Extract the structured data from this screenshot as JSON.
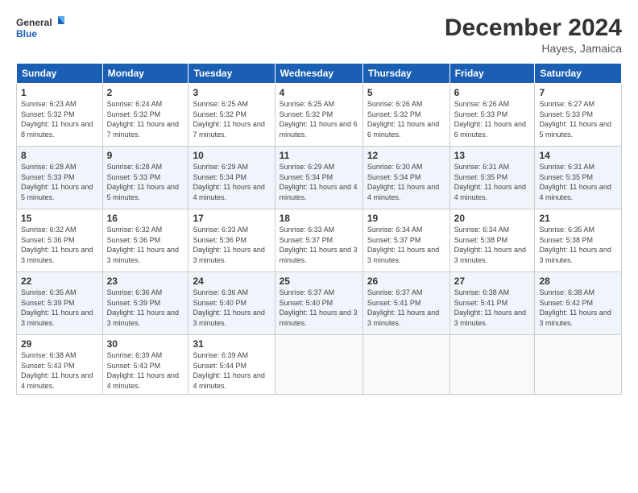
{
  "logo": {
    "line1": "General",
    "line2": "Blue"
  },
  "title": "December 2024",
  "location": "Hayes, Jamaica",
  "weekdays": [
    "Sunday",
    "Monday",
    "Tuesday",
    "Wednesday",
    "Thursday",
    "Friday",
    "Saturday"
  ],
  "weeks": [
    [
      {
        "day": "1",
        "sunrise": "6:23 AM",
        "sunset": "5:32 PM",
        "daylight": "11 hours and 8 minutes."
      },
      {
        "day": "2",
        "sunrise": "6:24 AM",
        "sunset": "5:32 PM",
        "daylight": "11 hours and 7 minutes."
      },
      {
        "day": "3",
        "sunrise": "6:25 AM",
        "sunset": "5:32 PM",
        "daylight": "11 hours and 7 minutes."
      },
      {
        "day": "4",
        "sunrise": "6:25 AM",
        "sunset": "5:32 PM",
        "daylight": "11 hours and 6 minutes."
      },
      {
        "day": "5",
        "sunrise": "6:26 AM",
        "sunset": "5:32 PM",
        "daylight": "11 hours and 6 minutes."
      },
      {
        "day": "6",
        "sunrise": "6:26 AM",
        "sunset": "5:33 PM",
        "daylight": "11 hours and 6 minutes."
      },
      {
        "day": "7",
        "sunrise": "6:27 AM",
        "sunset": "5:33 PM",
        "daylight": "11 hours and 5 minutes."
      }
    ],
    [
      {
        "day": "8",
        "sunrise": "6:28 AM",
        "sunset": "5:33 PM",
        "daylight": "11 hours and 5 minutes."
      },
      {
        "day": "9",
        "sunrise": "6:28 AM",
        "sunset": "5:33 PM",
        "daylight": "11 hours and 5 minutes."
      },
      {
        "day": "10",
        "sunrise": "6:29 AM",
        "sunset": "5:34 PM",
        "daylight": "11 hours and 4 minutes."
      },
      {
        "day": "11",
        "sunrise": "6:29 AM",
        "sunset": "5:34 PM",
        "daylight": "11 hours and 4 minutes."
      },
      {
        "day": "12",
        "sunrise": "6:30 AM",
        "sunset": "5:34 PM",
        "daylight": "11 hours and 4 minutes."
      },
      {
        "day": "13",
        "sunrise": "6:31 AM",
        "sunset": "5:35 PM",
        "daylight": "11 hours and 4 minutes."
      },
      {
        "day": "14",
        "sunrise": "6:31 AM",
        "sunset": "5:35 PM",
        "daylight": "11 hours and 4 minutes."
      }
    ],
    [
      {
        "day": "15",
        "sunrise": "6:32 AM",
        "sunset": "5:36 PM",
        "daylight": "11 hours and 3 minutes."
      },
      {
        "day": "16",
        "sunrise": "6:32 AM",
        "sunset": "5:36 PM",
        "daylight": "11 hours and 3 minutes."
      },
      {
        "day": "17",
        "sunrise": "6:33 AM",
        "sunset": "5:36 PM",
        "daylight": "11 hours and 3 minutes."
      },
      {
        "day": "18",
        "sunrise": "6:33 AM",
        "sunset": "5:37 PM",
        "daylight": "11 hours and 3 minutes."
      },
      {
        "day": "19",
        "sunrise": "6:34 AM",
        "sunset": "5:37 PM",
        "daylight": "11 hours and 3 minutes."
      },
      {
        "day": "20",
        "sunrise": "6:34 AM",
        "sunset": "5:38 PM",
        "daylight": "11 hours and 3 minutes."
      },
      {
        "day": "21",
        "sunrise": "6:35 AM",
        "sunset": "5:38 PM",
        "daylight": "11 hours and 3 minutes."
      }
    ],
    [
      {
        "day": "22",
        "sunrise": "6:35 AM",
        "sunset": "5:39 PM",
        "daylight": "11 hours and 3 minutes."
      },
      {
        "day": "23",
        "sunrise": "6:36 AM",
        "sunset": "5:39 PM",
        "daylight": "11 hours and 3 minutes."
      },
      {
        "day": "24",
        "sunrise": "6:36 AM",
        "sunset": "5:40 PM",
        "daylight": "11 hours and 3 minutes."
      },
      {
        "day": "25",
        "sunrise": "6:37 AM",
        "sunset": "5:40 PM",
        "daylight": "11 hours and 3 minutes."
      },
      {
        "day": "26",
        "sunrise": "6:37 AM",
        "sunset": "5:41 PM",
        "daylight": "11 hours and 3 minutes."
      },
      {
        "day": "27",
        "sunrise": "6:38 AM",
        "sunset": "5:41 PM",
        "daylight": "11 hours and 3 minutes."
      },
      {
        "day": "28",
        "sunrise": "6:38 AM",
        "sunset": "5:42 PM",
        "daylight": "11 hours and 3 minutes."
      }
    ],
    [
      {
        "day": "29",
        "sunrise": "6:38 AM",
        "sunset": "5:43 PM",
        "daylight": "11 hours and 4 minutes."
      },
      {
        "day": "30",
        "sunrise": "6:39 AM",
        "sunset": "5:43 PM",
        "daylight": "11 hours and 4 minutes."
      },
      {
        "day": "31",
        "sunrise": "6:39 AM",
        "sunset": "5:44 PM",
        "daylight": "11 hours and 4 minutes."
      },
      null,
      null,
      null,
      null
    ]
  ]
}
